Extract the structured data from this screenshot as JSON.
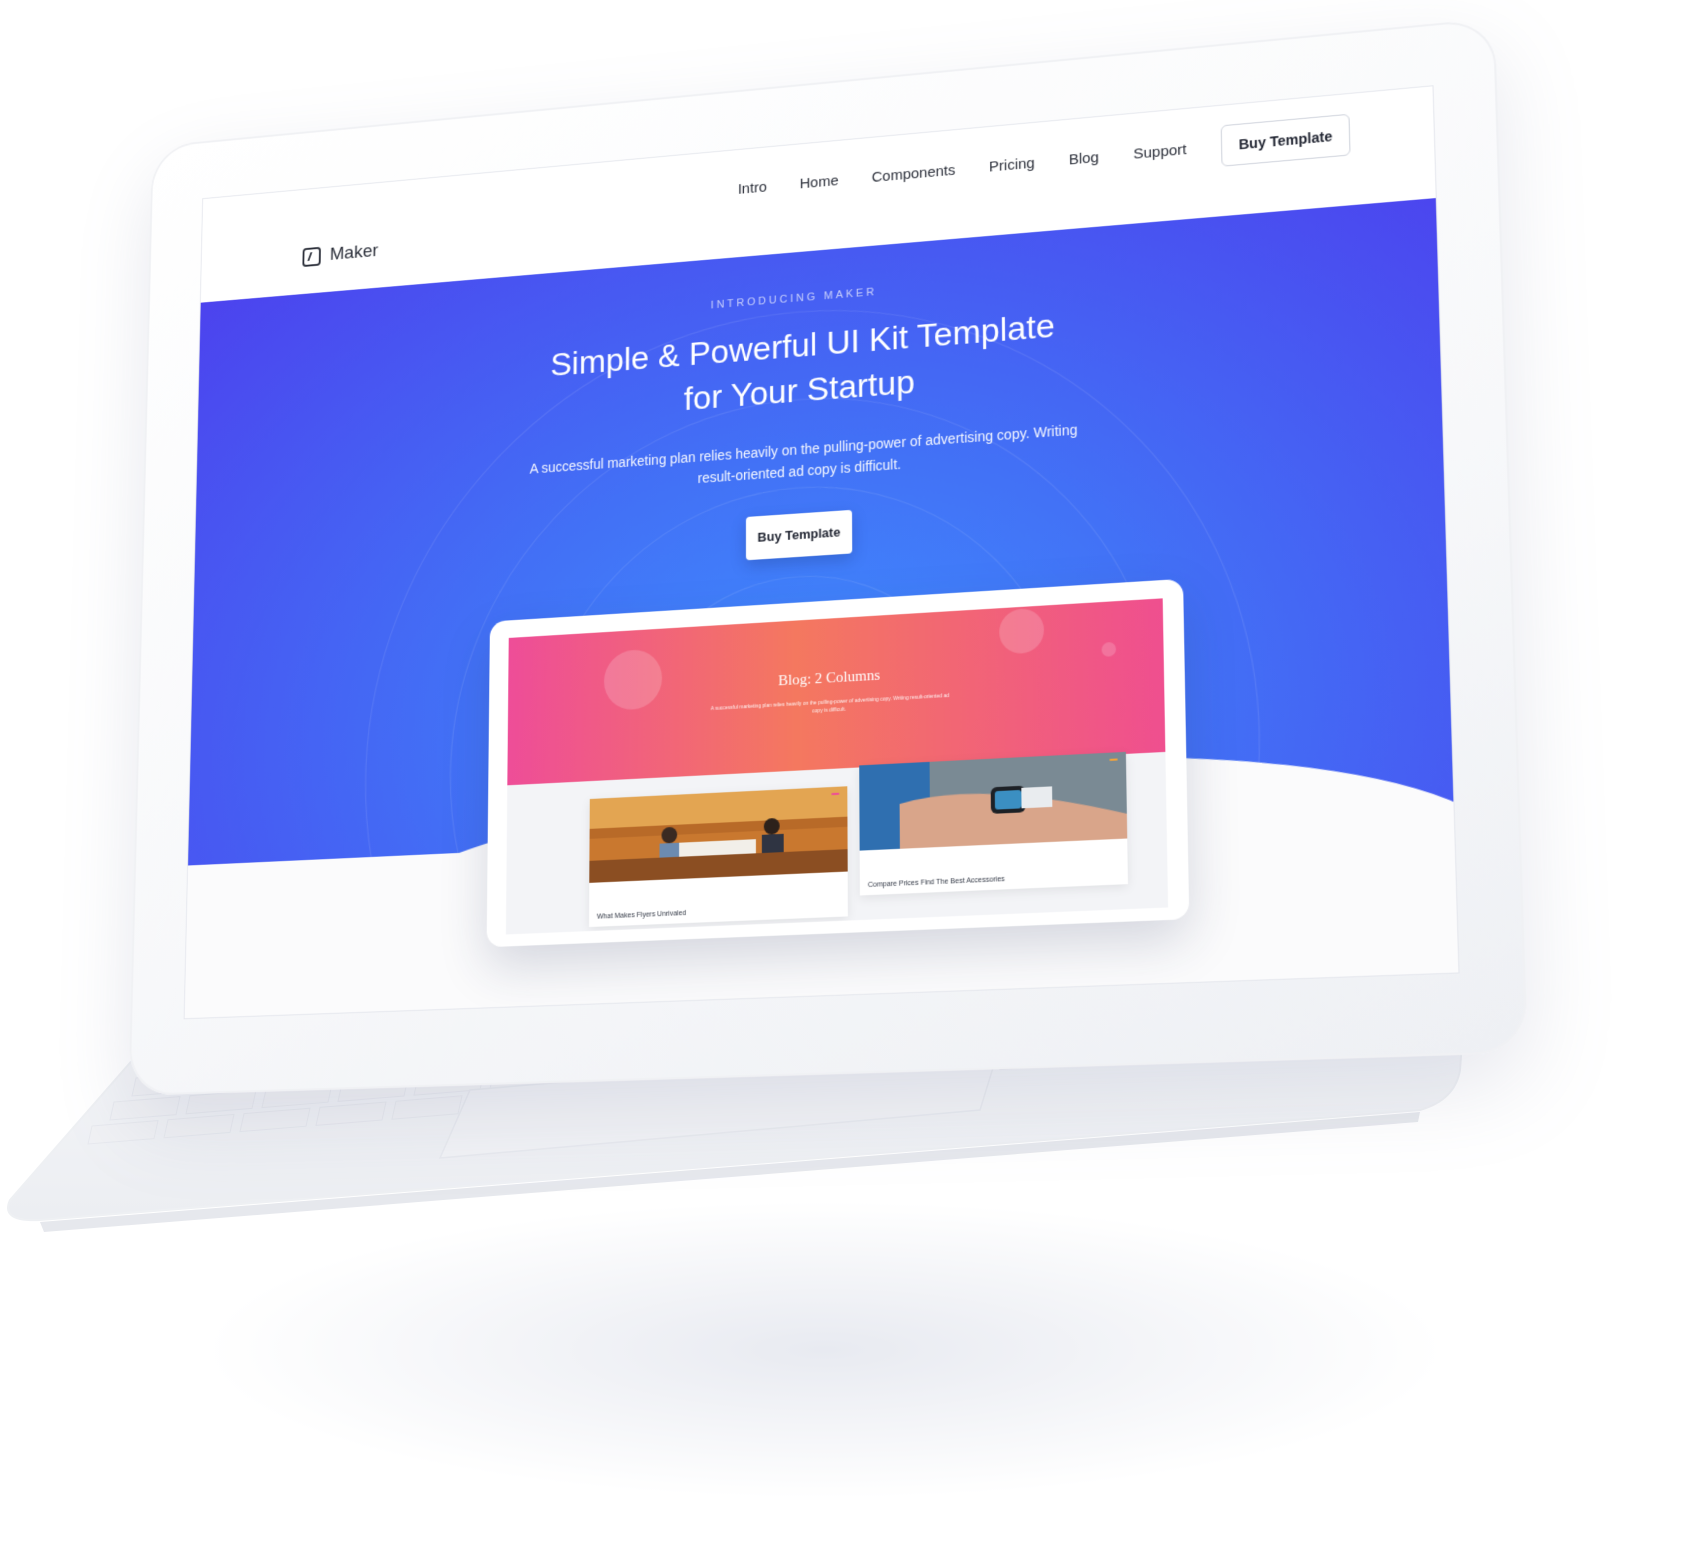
{
  "navbar": {
    "brand": "Maker",
    "items": [
      {
        "label": "Intro"
      },
      {
        "label": "Home"
      },
      {
        "label": "Components"
      },
      {
        "label": "Pricing"
      },
      {
        "label": "Blog"
      },
      {
        "label": "Support"
      }
    ],
    "cta_label": "Buy Template"
  },
  "hero": {
    "eyebrow": "INTRODUCING MAKER",
    "title_line1": "Simple & Powerful UI Kit Template",
    "title_line2": "for Your Startup",
    "subtitle": "A successful marketing plan relies heavily on the pulling-power of advertising copy. Writing result-oriented ad copy is difficult.",
    "cta_label": "Buy Template",
    "colors": {
      "start": "#4c42ee",
      "end": "#3f8cff"
    }
  },
  "mockup": {
    "title": "Blog: 2 Columns",
    "subtitle": "A successful marketing plan relies heavily on the pulling-power of advertising copy. Writing result-oriented ad copy is difficult.",
    "cards": [
      {
        "caption": "What Makes Flyers Unrivaled",
        "badge": "",
        "badge_color": "#ee4d98",
        "icon": "meeting-photo"
      },
      {
        "caption": "Compare Prices Find The Best Accessories",
        "badge": "",
        "badge_color": "#f4a33a",
        "icon": "smartwatch-photo"
      }
    ],
    "colors": {
      "start": "#ee4d98",
      "mid": "#f4785f"
    }
  }
}
